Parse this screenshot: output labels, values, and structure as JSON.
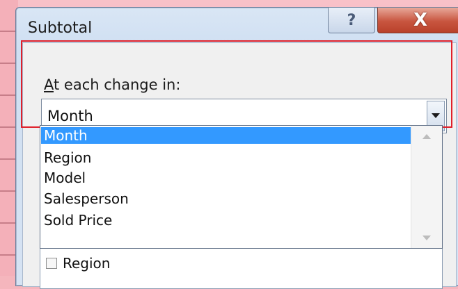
{
  "dialog": {
    "title": "Subtotal",
    "help_glyph": "?",
    "close_glyph": "X"
  },
  "group_by": {
    "label_accel": "A",
    "label_rest": "t each change in:",
    "value": "Month",
    "options": [
      "Month",
      "Region",
      "Model",
      "Salesperson",
      "Sold Price"
    ],
    "selected_index": 0
  },
  "add_subtotal_list": {
    "items": [
      {
        "label": "Region",
        "checked": false
      }
    ]
  },
  "colors": {
    "selection": "#3399ff",
    "highlight_box": "#e0202a",
    "close_button": "#c8553f"
  }
}
